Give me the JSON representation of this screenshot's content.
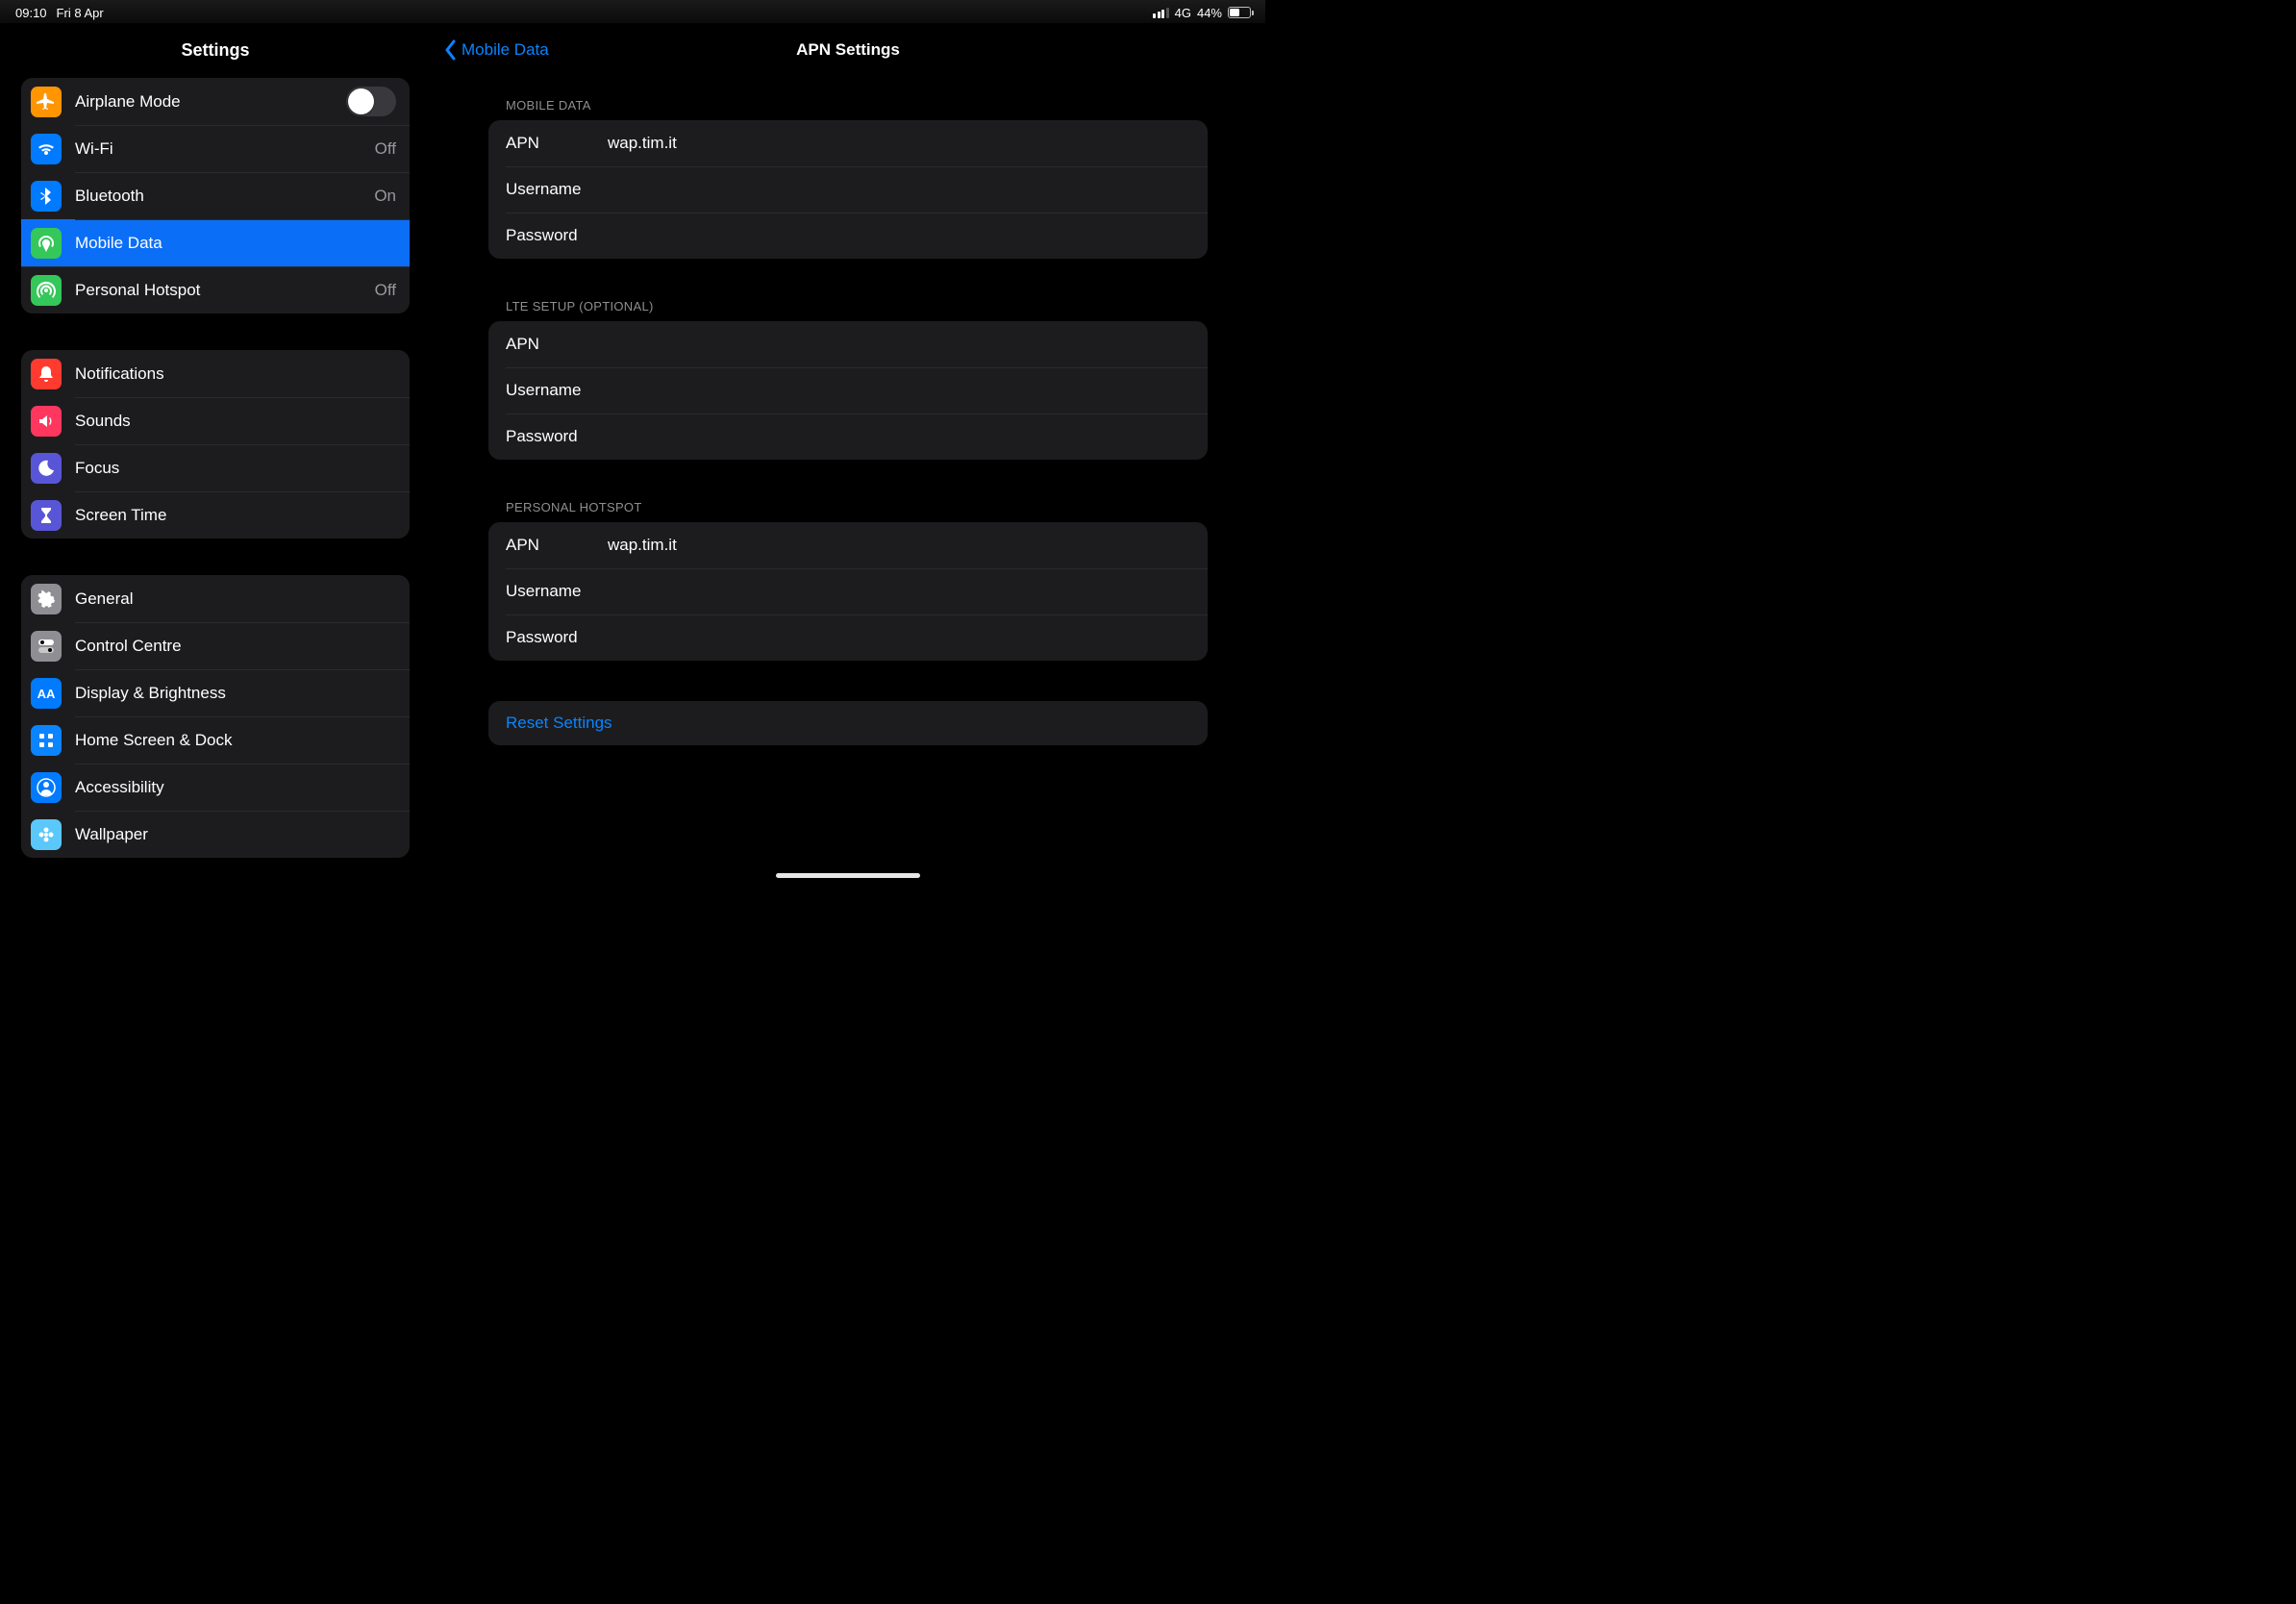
{
  "status": {
    "time": "09:10",
    "date": "Fri 8 Apr",
    "network": "4G",
    "battery_pct": "44%"
  },
  "sidebar": {
    "title": "Settings",
    "groups": [
      {
        "rows": [
          {
            "id": "airplane",
            "label": "Airplane Mode",
            "icon": "airplane-icon",
            "color": "c-orange",
            "toggle": true,
            "toggle_on": false
          },
          {
            "id": "wifi",
            "label": "Wi-Fi",
            "icon": "wifi-icon",
            "color": "c-blue",
            "value": "Off"
          },
          {
            "id": "bluetooth",
            "label": "Bluetooth",
            "icon": "bluetooth-icon",
            "color": "c-blue",
            "value": "On"
          },
          {
            "id": "mobiledata",
            "label": "Mobile Data",
            "icon": "antenna-icon",
            "color": "c-green",
            "selected": true
          },
          {
            "id": "hotspot",
            "label": "Personal Hotspot",
            "icon": "hotspot-icon",
            "color": "c-green",
            "value": "Off"
          }
        ]
      },
      {
        "rows": [
          {
            "id": "notifications",
            "label": "Notifications",
            "icon": "bell-icon",
            "color": "c-red"
          },
          {
            "id": "sounds",
            "label": "Sounds",
            "icon": "speaker-icon",
            "color": "c-pink"
          },
          {
            "id": "focus",
            "label": "Focus",
            "icon": "moon-icon",
            "color": "c-indigo"
          },
          {
            "id": "screentime",
            "label": "Screen Time",
            "icon": "hourglass-icon",
            "color": "c-indigo"
          }
        ]
      },
      {
        "rows": [
          {
            "id": "general",
            "label": "General",
            "icon": "gear-icon",
            "color": "c-gray"
          },
          {
            "id": "controlcentre",
            "label": "Control Centre",
            "icon": "switches-icon",
            "color": "c-gray"
          },
          {
            "id": "display",
            "label": "Display & Brightness",
            "icon": "aa-icon",
            "color": "c-blue"
          },
          {
            "id": "homescreen",
            "label": "Home Screen & Dock",
            "icon": "grid-icon",
            "color": "c-bluel"
          },
          {
            "id": "accessibility",
            "label": "Accessibility",
            "icon": "person-icon",
            "color": "c-blue"
          },
          {
            "id": "wallpaper",
            "label": "Wallpaper",
            "icon": "flower-icon",
            "color": "c-teal"
          }
        ]
      }
    ]
  },
  "detail": {
    "back_label": "Mobile Data",
    "title": "APN Settings",
    "sections": [
      {
        "header": "MOBILE DATA",
        "fields": [
          {
            "label": "APN",
            "value": "wap.tim.it"
          },
          {
            "label": "Username",
            "value": ""
          },
          {
            "label": "Password",
            "value": ""
          }
        ]
      },
      {
        "header": "LTE SETUP (OPTIONAL)",
        "fields": [
          {
            "label": "APN",
            "value": ""
          },
          {
            "label": "Username",
            "value": ""
          },
          {
            "label": "Password",
            "value": ""
          }
        ]
      },
      {
        "header": "PERSONAL HOTSPOT",
        "fields": [
          {
            "label": "APN",
            "value": "wap.tim.it"
          },
          {
            "label": "Username",
            "value": ""
          },
          {
            "label": "Password",
            "value": ""
          }
        ]
      }
    ],
    "reset_label": "Reset Settings"
  }
}
